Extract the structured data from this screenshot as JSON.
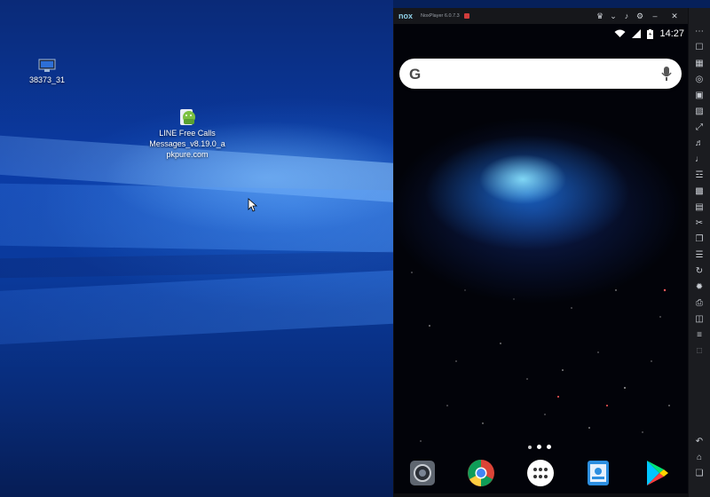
{
  "desktop": {
    "icons": [
      {
        "label": "38373_31",
        "icon": "monitor-icon"
      },
      {
        "label_lines": [
          "LINE Free Calls",
          "Messages_v8.19.0_a",
          "pkpure.com"
        ],
        "icon": "android-apk-icon"
      }
    ]
  },
  "nox": {
    "title": "NoxPlayer 6.0.7.3",
    "title_controls": [
      "account-icon",
      "chevron-down-icon",
      "sound-icon",
      "settings-icon",
      "minimize-icon",
      "close-icon"
    ],
    "status": {
      "time": "14:27",
      "icons": [
        "wifi-icon",
        "signal-icon",
        "battery-icon"
      ]
    },
    "search": {
      "logo": "G"
    },
    "dock": [
      "camera-app",
      "chrome-app",
      "app-drawer",
      "files-app",
      "play-store-app"
    ],
    "toolbar": [
      "more-icon",
      "fullscreen-icon",
      "keyboard-icon",
      "location-icon",
      "screen-icon",
      "apk-icon",
      "resize-icon",
      "volume-up-icon",
      "volume-down-icon",
      "shake-icon",
      "screenshot-icon",
      "toolbox-icon",
      "scissors-icon",
      "multi-instance-icon",
      "menu-icon",
      "sync-icon",
      "loading-icon",
      "print-icon",
      "record-icon",
      "adjust-icon",
      "disabled-icon",
      "back-icon",
      "home-icon",
      "recent-apps-icon"
    ]
  }
}
